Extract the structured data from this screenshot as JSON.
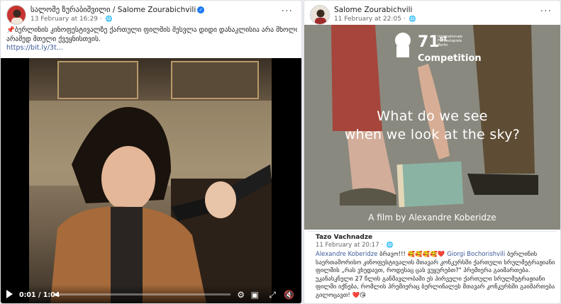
{
  "left_post": {
    "author": "სალომე ზურაბიშვილი / Salome Zourabichvili",
    "timestamp": "13 February at 16:29 · ",
    "text_lines": [
      "📌ბერლინის კინოფესტივალზე ქართული ფილმის შესვლა დიდი დანაკლისია არა მხოლოდ ოჯახის,",
      "არამედ მთელი ქვეყნისთვის."
    ],
    "link": "https://bit.ly/3t...",
    "video": {
      "current_time": "0:01",
      "separator": " / ",
      "duration": "1:04",
      "progress": 0.02
    }
  },
  "right_post": {
    "author": "Salome Zourabichvili",
    "timestamp": "11 February at 22:05 · ",
    "poster": {
      "competition_number": "71",
      "competition_superscript": "st",
      "festival_lines": [
        "Internationale",
        "Filmfestspiele",
        "Berlin"
      ],
      "competition_word": "Competition",
      "headline_line1": "What do we see",
      "headline_line2": "when we look at the sky?",
      "credit": "A film by Alexandre Koberidze"
    },
    "comment": {
      "author": "Tazo Vachnadze",
      "timestamp": "11 February at 20:17 · ",
      "mention1": "Alexandre Koberidze",
      "lines": [
        " ბრავო!!! 🥰🥰🥰🥰❤️ ",
        "საერთაშორისო კინოფესტივალის მთავარ კონკურსში ქართული სრულმეტრაჟიანი",
        "ფილმის „რას ვხედავთ, როდესაც ცას ვუყურებთ?\" პრემიერა გაიმართება.",
        "უკანასკნელი 27 წლის განმავლობაში ეს პირველი ქართული სრულმეტრაჟიანი",
        "ფილმი იქნება, რომლის პრემიერაც ბერლინალეს მთავარ კონკურსში გაიმართება.",
        "გილოცავთ! ❤️😘"
      ],
      "mention2": "Giorgi Bochorishvili",
      "mention2_suffix": " ბერლინის"
    }
  }
}
